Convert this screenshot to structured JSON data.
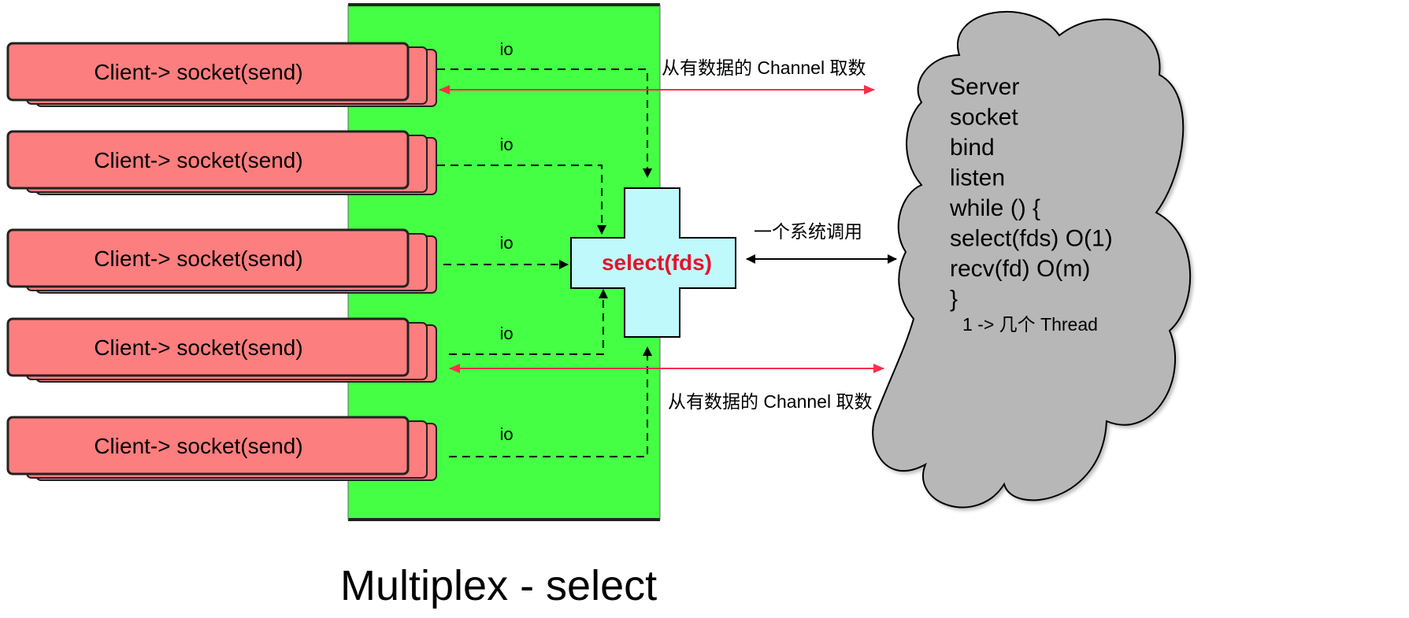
{
  "title": "Multiplex - select",
  "colors": {
    "client_fill": "#fd7e7e",
    "channel_fill": "#44ff44",
    "select_fill": "#bff9fb",
    "server_fill": "#b7b7b7",
    "accent_red": "#ff2d4a",
    "select_text": "#e8112d"
  },
  "clients": [
    {
      "label": "Client-> socket(send)",
      "io": "io"
    },
    {
      "label": "Client-> socket(send)",
      "io": "io"
    },
    {
      "label": "Client-> socket(send)",
      "io": "io"
    },
    {
      "label": "Client-> socket(send)",
      "io": "io"
    },
    {
      "label": "Client-> socket(send)",
      "io": "io"
    }
  ],
  "select_box": {
    "label": "select(fds)"
  },
  "edges": {
    "fetch_top": "从有数据的 Channel  取数",
    "fetch_bottom": "从有数据的 Channel  取数",
    "syscall": "一个系统调用"
  },
  "server": {
    "lines": [
      "Server",
      "socket",
      "bind",
      "listen",
      "while () {",
      "select(fds) O(1)",
      "recv(fd) O(m)",
      "}"
    ],
    "note": "1 -> 几个 Thread"
  }
}
